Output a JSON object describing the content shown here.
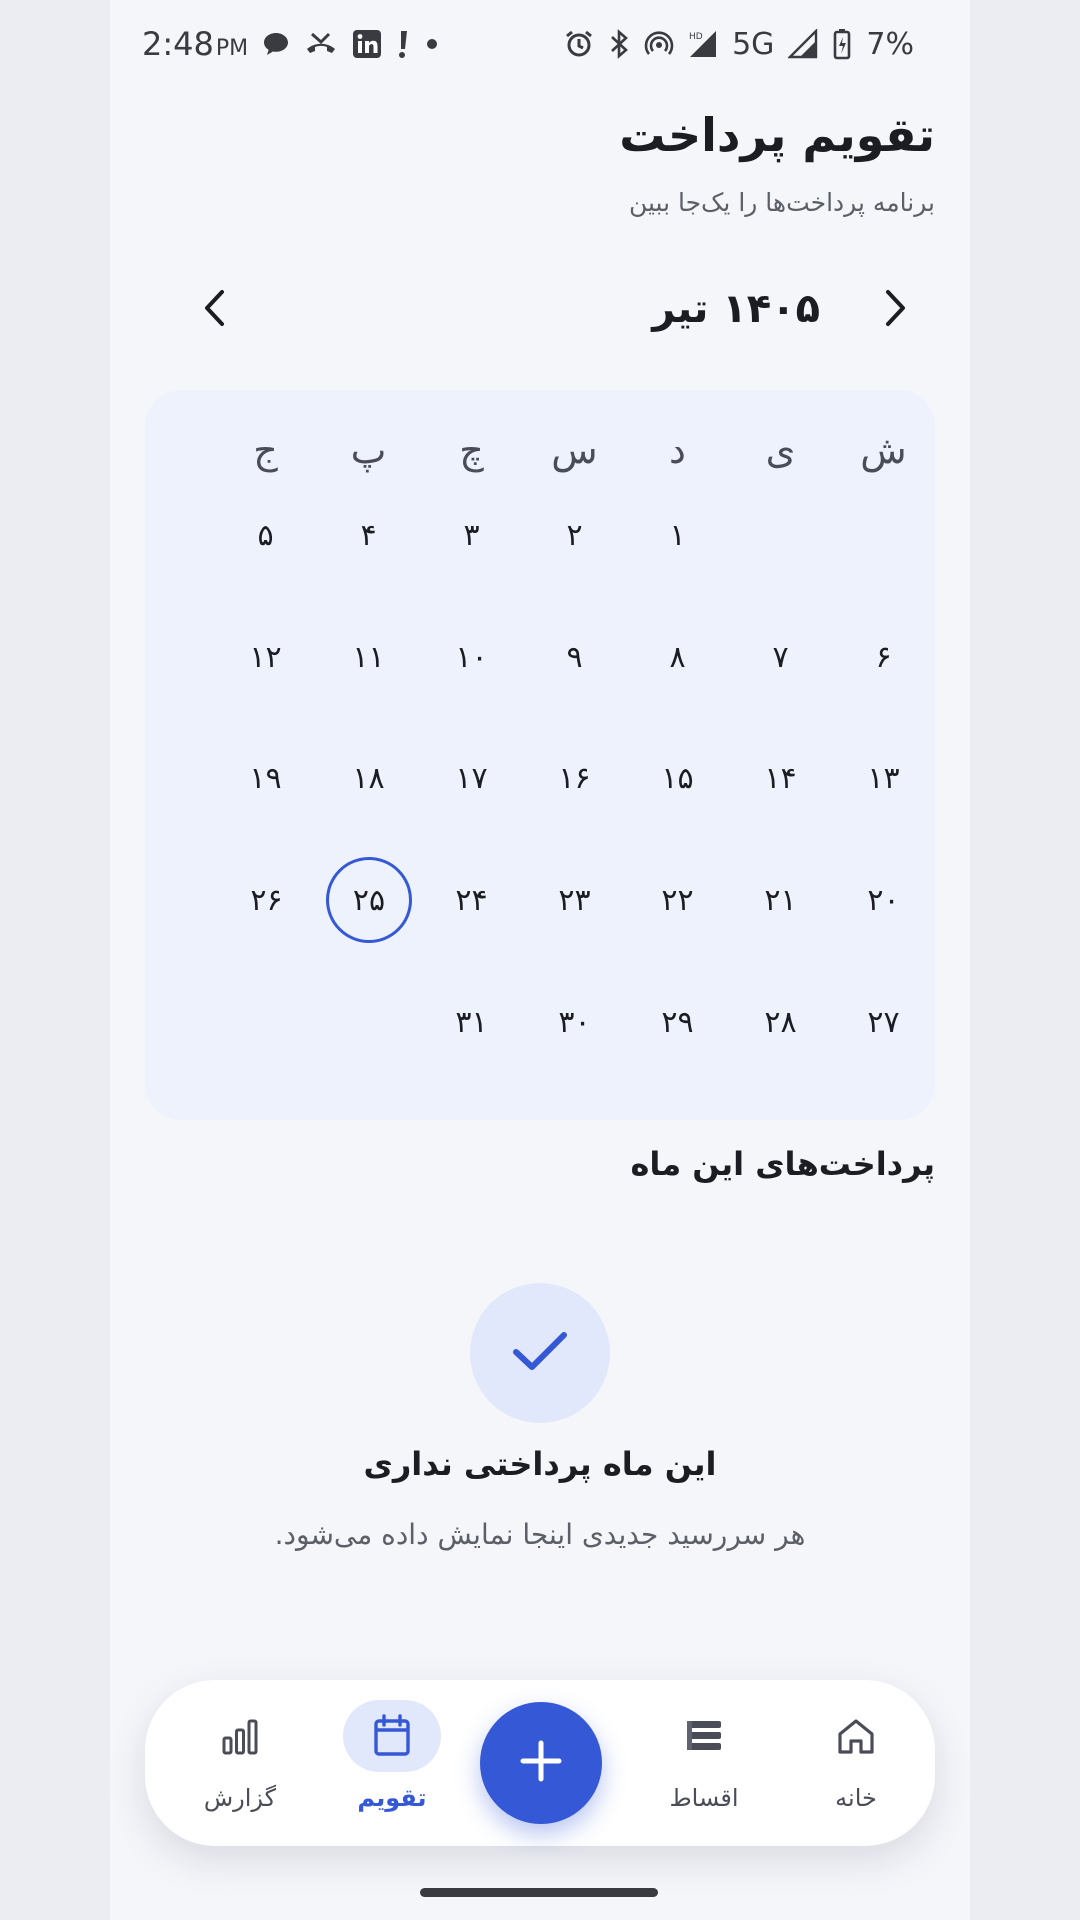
{
  "status_bar": {
    "time": "2:48",
    "ampm": "PM",
    "network": "5G",
    "battery": "7%",
    "hd": "HD",
    "left_icons": [
      "chat-bubble-icon",
      "missed-call-icon",
      "linkedin-icon",
      "exclamation-icon",
      "dot-icon"
    ],
    "right_icons": [
      "alarm-icon",
      "bluetooth-icon",
      "hotspot-icon",
      "signal-icon",
      "signal-hd-icon",
      "battery-charging-icon"
    ]
  },
  "header": {
    "title": "تقویم پرداخت",
    "subtitle": "برنامه پرداخت‌ها را یک‌جا ببین"
  },
  "month_nav": {
    "label": "۱۴۰۵ تیر",
    "next_icon": "chevron-right-icon",
    "prev_icon": "chevron-left-icon"
  },
  "calendar": {
    "weekdays": [
      "ش",
      "ی",
      "د",
      "س",
      "چ",
      "پ",
      "ج"
    ],
    "weeks": [
      [
        "",
        "",
        "۱",
        "۲",
        "۳",
        "۴",
        "۵"
      ],
      [
        "۶",
        "۷",
        "۸",
        "۹",
        "۱۰",
        "۱۱",
        "۱۲"
      ],
      [
        "۱۳",
        "۱۴",
        "۱۵",
        "۱۶",
        "۱۷",
        "۱۸",
        "۱۹"
      ],
      [
        "۲۰",
        "۲۱",
        "۲۲",
        "۲۳",
        "۲۴",
        "۲۵",
        "۲۶"
      ],
      [
        "۲۷",
        "۲۸",
        "۲۹",
        "۳۰",
        "۳۱",
        "",
        ""
      ]
    ],
    "today": "۲۵"
  },
  "payments": {
    "section_title": "پرداخت‌های این ماه",
    "empty_icon": "checkmark-icon",
    "empty_title": "این ماه پرداختی نداری",
    "empty_desc": "هر سررسید جدیدی اینجا نمایش داده می‌شود."
  },
  "bottom_nav": {
    "items": [
      {
        "label": "خانه",
        "icon": "home-icon",
        "active": false
      },
      {
        "label": "اقساط",
        "icon": "list-icon",
        "active": false
      },
      {
        "label": "تقویم",
        "icon": "calendar-icon",
        "active": true
      },
      {
        "label": "گزارش",
        "icon": "bar-chart-icon",
        "active": false
      }
    ],
    "fab_icon": "plus-icon"
  },
  "colors": {
    "accent": "#3558d6",
    "accent_soft": "#e2e8fb",
    "calendar_bg": "#eef2fc",
    "page_bg": "#f5f6fa",
    "text": "#1c1d22"
  }
}
